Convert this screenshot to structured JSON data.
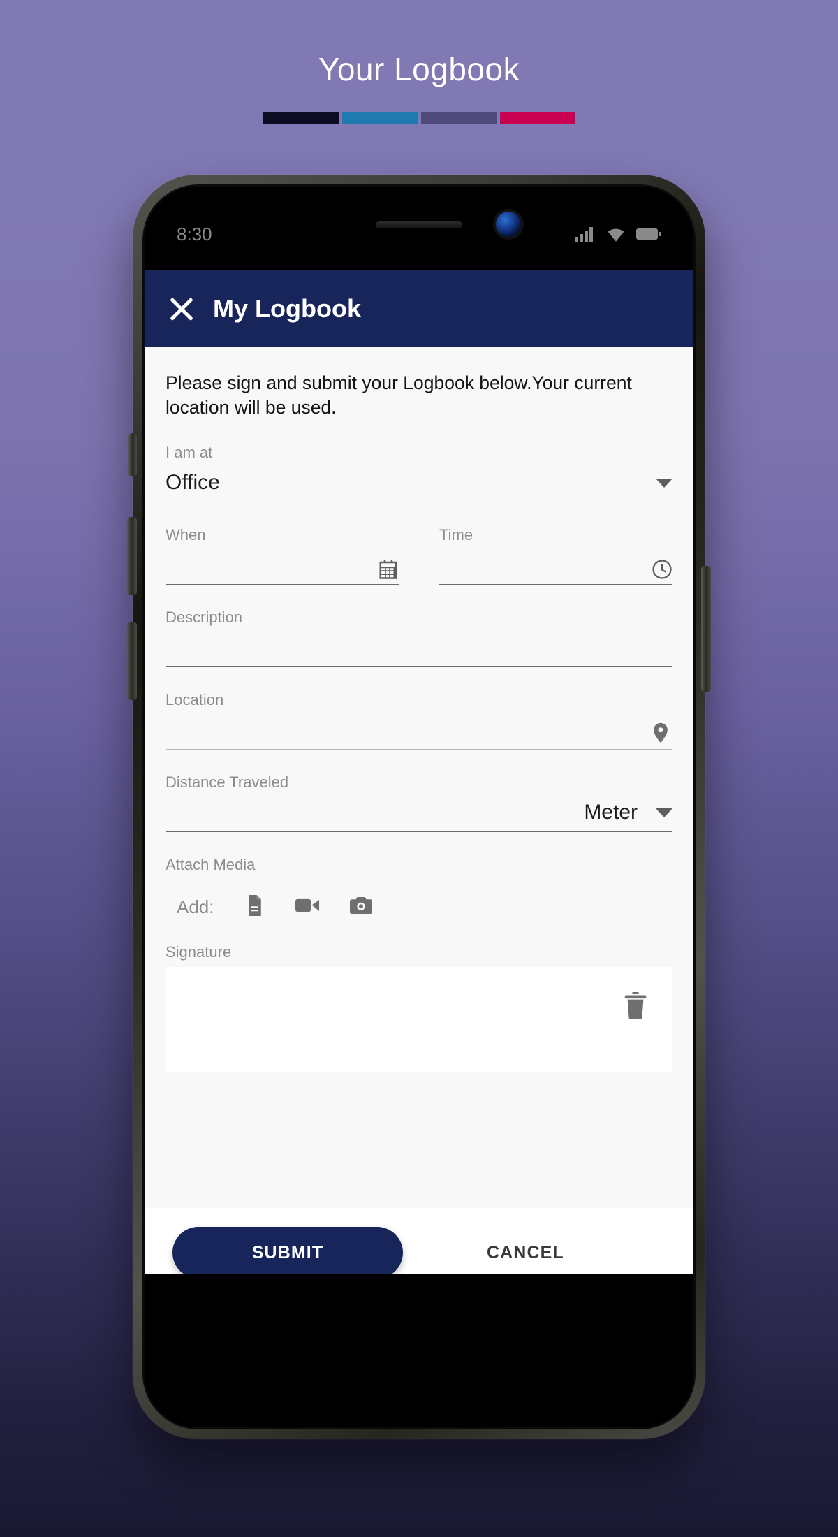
{
  "page": {
    "title": "Your Logbook",
    "accent_bars": [
      {
        "name": "bar-navy",
        "color": "#0d0c22"
      },
      {
        "name": "bar-blue",
        "color": "#1f7ab0"
      },
      {
        "name": "bar-purple",
        "color": "#4e4a7a"
      },
      {
        "name": "bar-crimson",
        "color": "#c80050"
      }
    ],
    "background_top": "#8179b4",
    "background_bottom": "#191831"
  },
  "status_bar": {
    "time": "8:30",
    "icons": [
      "signal-icon",
      "wifi-icon",
      "battery-icon"
    ]
  },
  "app": {
    "header": {
      "title": "My Logbook",
      "close_icon": "close-icon",
      "background": "#17255a"
    },
    "intro": "Please sign and submit your Logbook below.Your current location will be used.",
    "fields": {
      "i_am_at": {
        "label": "I am at",
        "value": "Office",
        "icon": "chevron-down-icon"
      },
      "when": {
        "label": "When",
        "value": "",
        "placeholder": "",
        "icon": "calendar-icon"
      },
      "time": {
        "label": "Time",
        "value": "",
        "placeholder": "",
        "icon": "clock-icon"
      },
      "description": {
        "label": "Description",
        "value": "",
        "placeholder": ""
      },
      "location": {
        "label": "Location",
        "value": "",
        "placeholder": "",
        "icon": "map-pin-icon"
      },
      "distance_traveled": {
        "label": "Distance Traveled",
        "value": "",
        "placeholder": "",
        "unit": "Meter",
        "unit_icon": "chevron-down-icon"
      },
      "attach_media": {
        "label": "Attach Media",
        "add_label": "Add:",
        "icons": [
          "document-icon",
          "video-camera-icon",
          "camera-icon"
        ]
      },
      "signature": {
        "label": "Signature",
        "clear_icon": "trash-icon"
      }
    },
    "actions": {
      "submit_label": "SUBMIT",
      "cancel_label": "CANCEL",
      "submit_color": "#17255a"
    }
  }
}
